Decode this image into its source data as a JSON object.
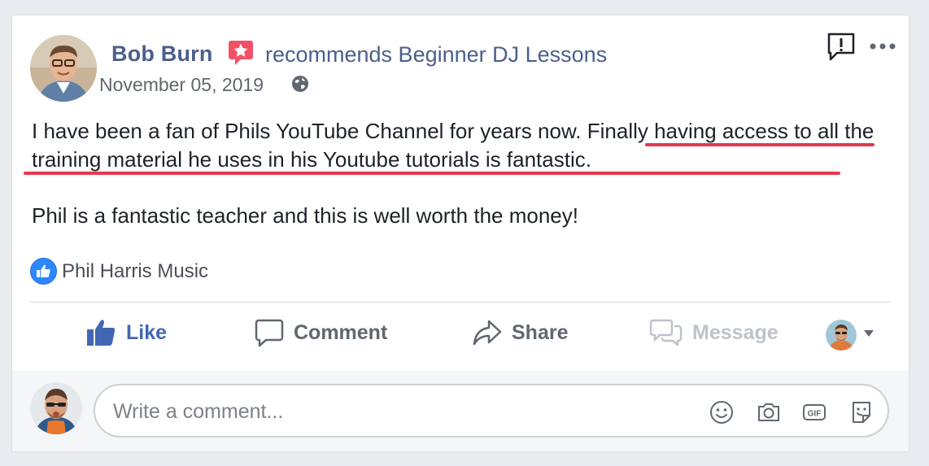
{
  "post": {
    "author": "Bob Burn",
    "action_text": "recommends Beginner DJ Lessons",
    "date": "November 05, 2019",
    "paragraph1_normal": "I have been a fan of Phils YouTube Channel for years now. ",
    "paragraph1_highlight": "Finally having access to all the training material he uses in his Youtube tutorials is fantastic.",
    "paragraph2": "Phil is a fantastic teacher and this is well worth the money!",
    "page_like_label": "Phil Harris Music",
    "highlight_color": "#e4394d"
  },
  "actions": {
    "like": "Like",
    "comment": "Comment",
    "share": "Share",
    "message": "Message"
  },
  "comment_box": {
    "placeholder": "Write a comment..."
  },
  "colors": {
    "name_blue": "#4b5f8c",
    "like_blue": "#4267b2",
    "recommend_pink": "#f25268"
  },
  "icons": [
    "recommend-star-icon",
    "globe-icon",
    "report-icon",
    "more-icon",
    "like-icon",
    "comment-icon",
    "share-icon",
    "message-icon",
    "caret-down-icon",
    "emoji-icon",
    "camera-icon",
    "gif-icon",
    "sticker-icon",
    "page-like-icon"
  ]
}
